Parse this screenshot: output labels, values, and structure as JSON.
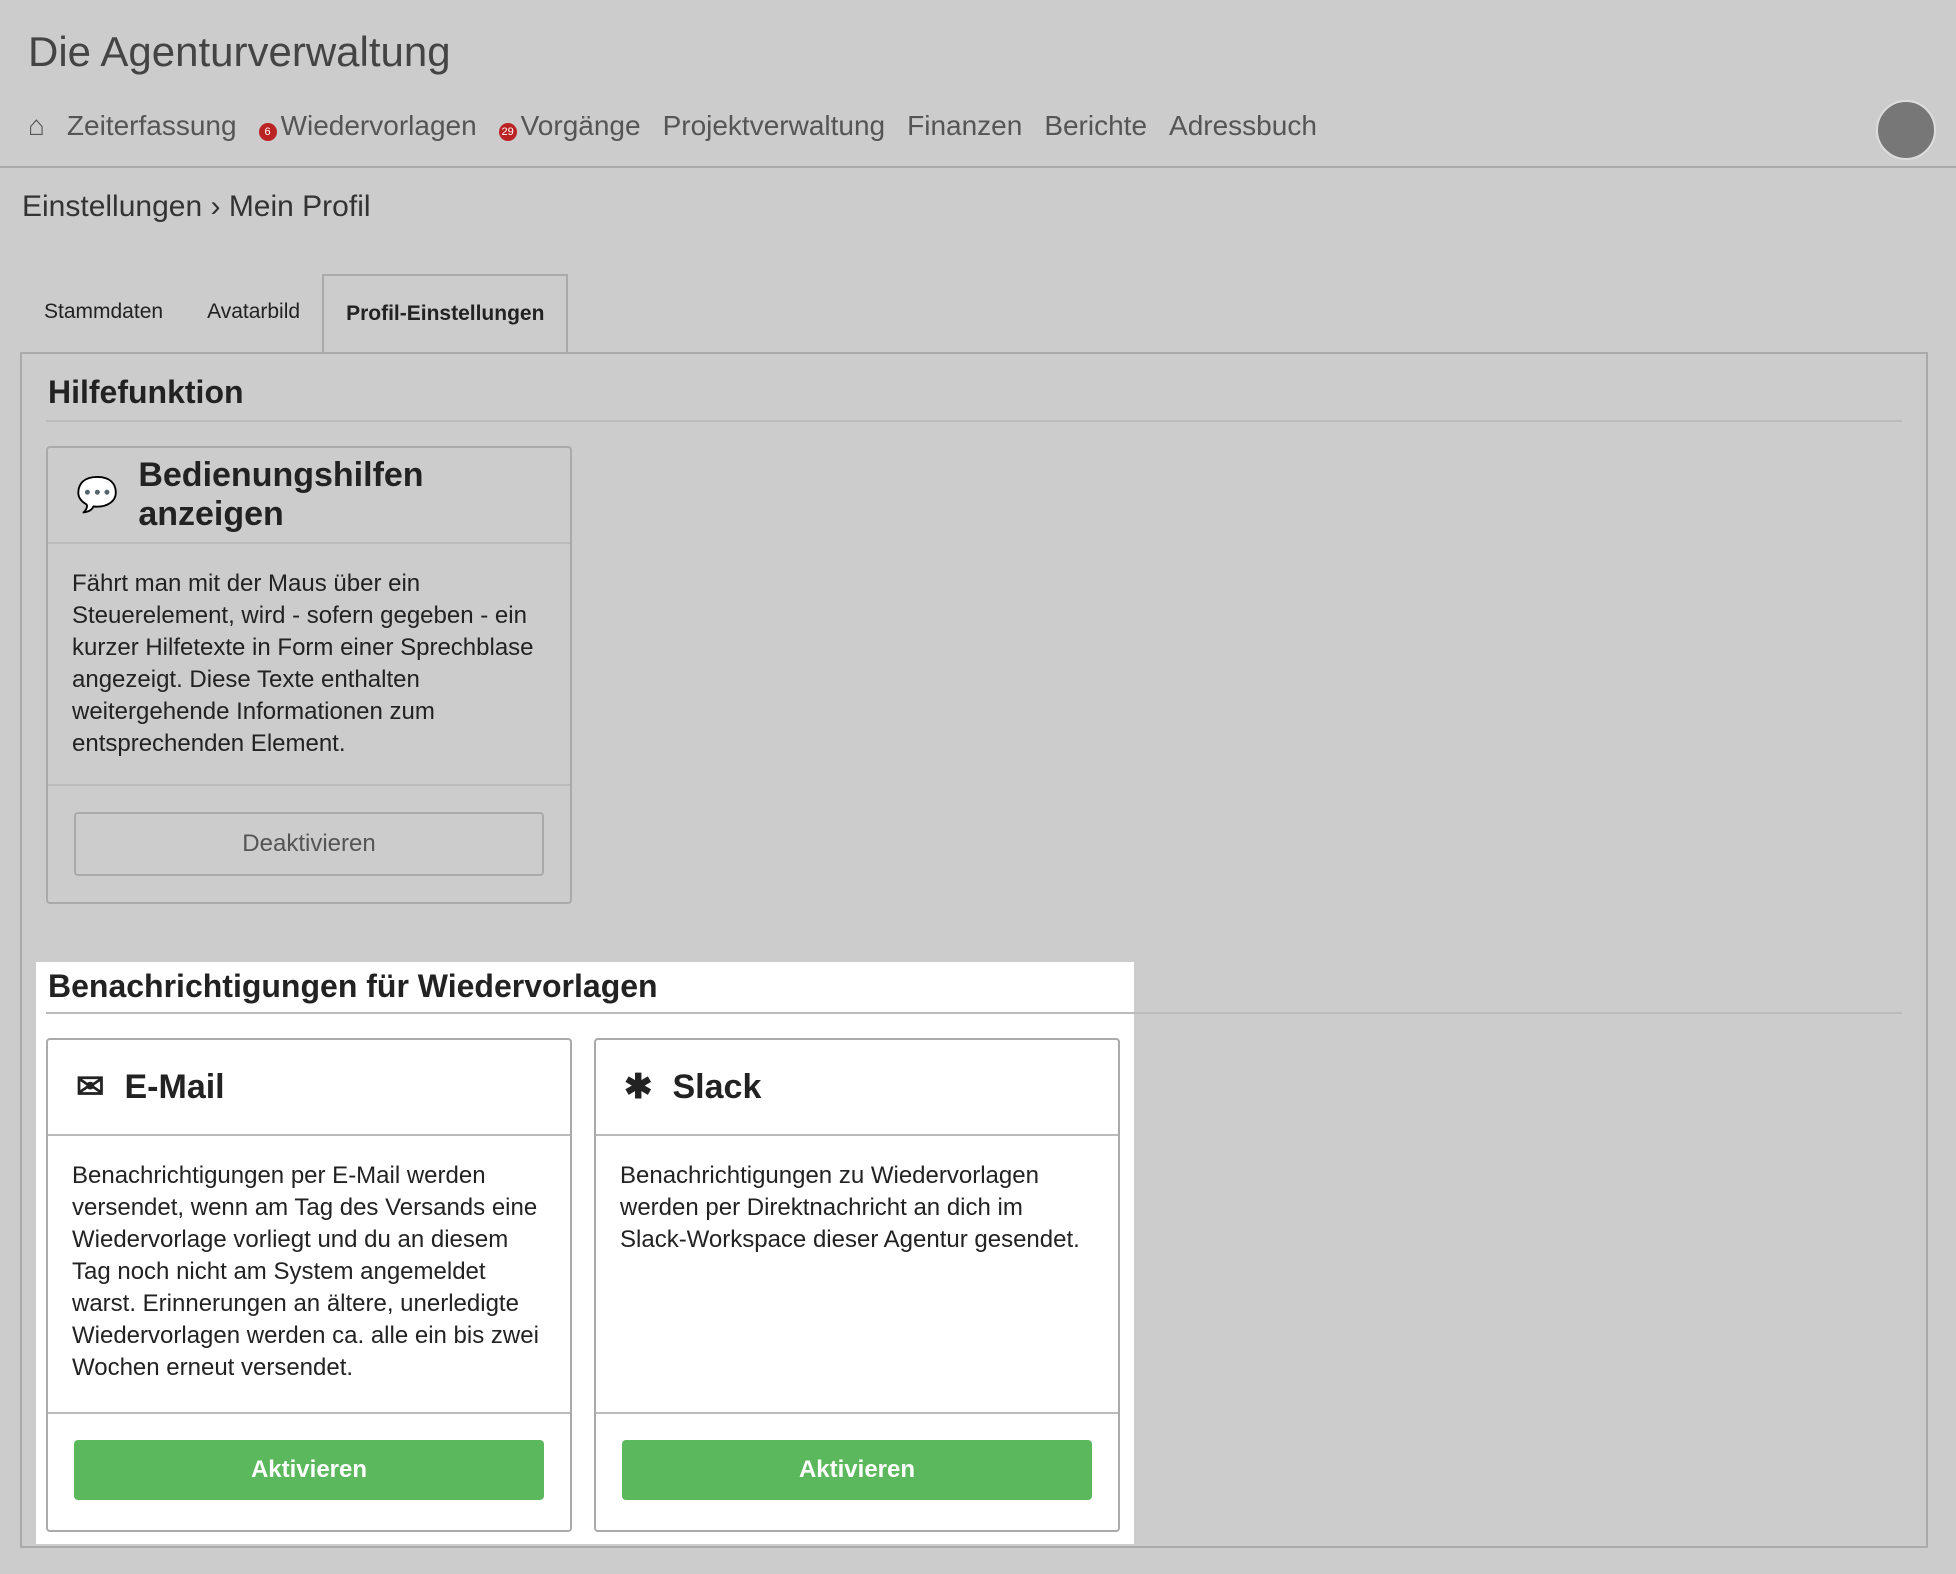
{
  "app": {
    "title": "Die Agenturverwaltung"
  },
  "nav": [
    {
      "label": "Zeiterfassung"
    },
    {
      "label": "Wiedervorlagen",
      "badge": "6"
    },
    {
      "label": "Vorgänge",
      "badge": "29"
    },
    {
      "label": "Projektverwaltung"
    },
    {
      "label": "Finanzen"
    },
    {
      "label": "Berichte"
    },
    {
      "label": "Adressbuch"
    }
  ],
  "breadcrumb": {
    "parent": "Einstellungen",
    "current": "Mein Profil"
  },
  "tabs": [
    {
      "label": "Stammdaten"
    },
    {
      "label": "Avatarbild"
    },
    {
      "label": "Profil-Einstellungen"
    }
  ],
  "help": {
    "heading": "Hilfefunktion",
    "title": "Bedienungshilfen anzeigen",
    "text": "Fährt man mit der Maus über ein Steuerelement, wird - sofern gegeben - ein kurzer Hilfetexte in Form einer Sprechblase angezeigt. Diese Texte enthalten weitergehende Informationen zum entsprechenden Element.",
    "button": "Deaktivieren"
  },
  "notify": {
    "heading": "Benachrichtigungen für Wiedervorlagen",
    "email": {
      "title": "E-Mail",
      "text": "Benachrichtigungen per E-Mail werden versendet, wenn am Tag des Versands eine Wiedervorlage vorliegt und du an diesem Tag noch nicht am System angemeldet warst. Erinnerungen an ältere, unerledigte Wiedervorlagen werden ca. alle ein bis zwei Wochen erneut versendet.",
      "button": "Aktivieren"
    },
    "slack": {
      "title": "Slack",
      "text": "Benachrichtigungen zu Wiedervorlagen werden per Direktnachricht an dich im Slack-Workspace dieser Agentur gesendet.",
      "button": "Aktivieren"
    }
  }
}
